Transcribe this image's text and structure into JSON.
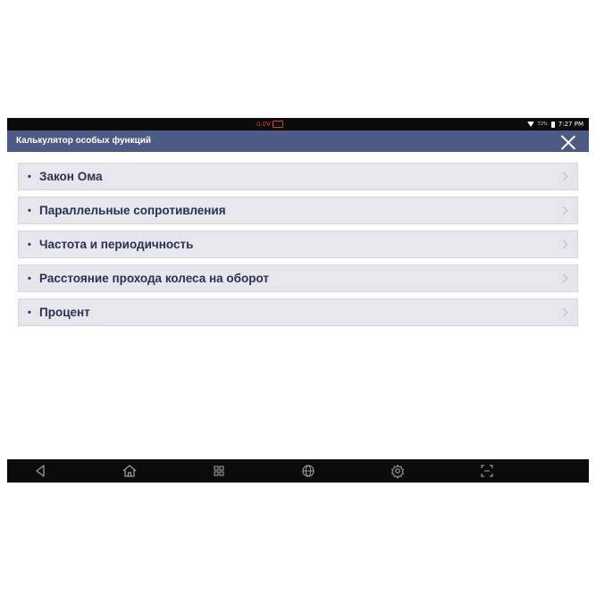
{
  "statusbar": {
    "voltage": "0.0V",
    "battery_percent": "72%",
    "time": "7:27 PM"
  },
  "titlebar": {
    "title": "Калькулятор особых функций"
  },
  "menu": {
    "bullet": "•",
    "items": [
      {
        "label": "Закон Ома"
      },
      {
        "label": "Параллельные сопротивления"
      },
      {
        "label": "Частота и периодичность"
      },
      {
        "label": "Расстояние прохода колеса на оборот"
      },
      {
        "label": "Процент"
      }
    ]
  },
  "navbar": {
    "icons": [
      "back-icon",
      "home-icon",
      "apps-icon",
      "globe-icon",
      "settings-icon",
      "screenshot-icon"
    ]
  },
  "colors": {
    "titlebar": "#4e5a86",
    "item_bg": "#e6e6ec",
    "item_text": "#2b3150",
    "voltage_warning": "#e53935"
  }
}
